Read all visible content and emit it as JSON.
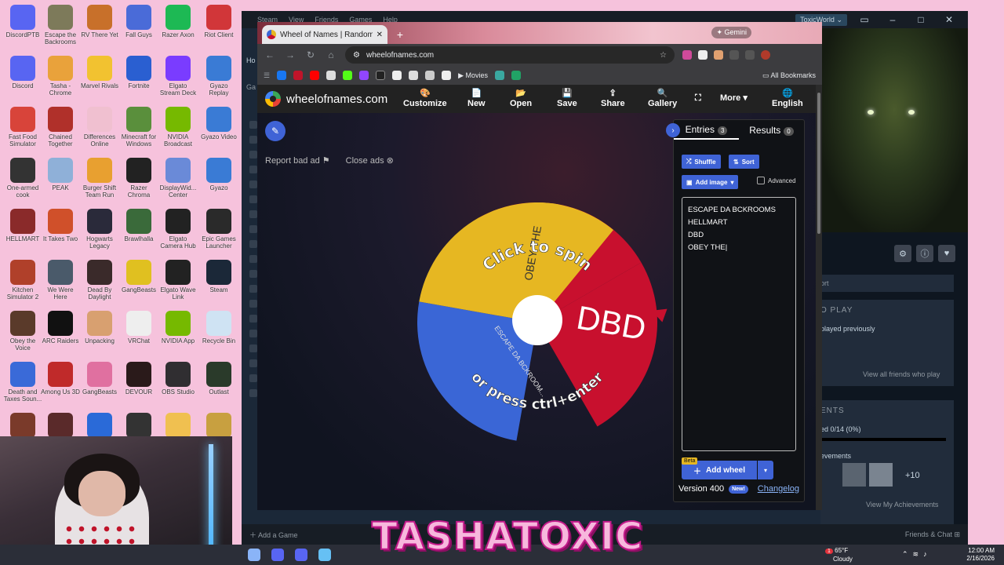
{
  "desktop": {
    "icons": [
      {
        "label": "DiscordPTB",
        "color": "#5865f2"
      },
      {
        "label": "Escape the Backrooms",
        "color": "#7d7a5a"
      },
      {
        "label": "RV There Yet",
        "color": "#c8702a"
      },
      {
        "label": "Fall Guys",
        "color": "#4a6bd8"
      },
      {
        "label": "Razer Axon",
        "color": "#1db954"
      },
      {
        "label": "Riot Client",
        "color": "#d13639"
      },
      {
        "label": "Discord",
        "color": "#5865f2"
      },
      {
        "label": "Tasha - Chrome",
        "color": "#e9a23b"
      },
      {
        "label": "Marvel Rivals",
        "color": "#f2c230"
      },
      {
        "label": "Fortnite",
        "color": "#2a5fd1"
      },
      {
        "label": "Elgato Stream Deck",
        "color": "#7a3cff"
      },
      {
        "label": "Gyazo Replay",
        "color": "#3a7bd5"
      },
      {
        "label": "Fast Food Simulator",
        "color": "#d8443a"
      },
      {
        "label": "Chained Together",
        "color": "#b0302a"
      },
      {
        "label": "Differences Online",
        "color": "#f0c0d0"
      },
      {
        "label": "Minecraft for Windows",
        "color": "#5a8f3c"
      },
      {
        "label": "NVIDIA Broadcast",
        "color": "#76b900"
      },
      {
        "label": "Gyazo Video",
        "color": "#3a7bd5"
      },
      {
        "label": "One-armed cook",
        "color": "#333333"
      },
      {
        "label": "PEAK",
        "color": "#8fb0d8"
      },
      {
        "label": "Burger Shift Team Run",
        "color": "#e8a030"
      },
      {
        "label": "Razer Chroma",
        "color": "#222222"
      },
      {
        "label": "DisplayWid... Center",
        "color": "#6a8ad8"
      },
      {
        "label": "Gyazo",
        "color": "#3a7bd5"
      },
      {
        "label": "HELLMART",
        "color": "#8a2a2a"
      },
      {
        "label": "It Takes Two",
        "color": "#d0502a"
      },
      {
        "label": "Hogwarts Legacy",
        "color": "#2a2a3a"
      },
      {
        "label": "Brawlhalla",
        "color": "#3a6a3a"
      },
      {
        "label": "Elgato Camera Hub",
        "color": "#222222"
      },
      {
        "label": "Epic Games Launcher",
        "color": "#2a2a2a"
      },
      {
        "label": "Kitchen Simulator 2",
        "color": "#b0402a"
      },
      {
        "label": "We Were Here",
        "color": "#4a5a6a"
      },
      {
        "label": "Dead By Daylight",
        "color": "#3a2a2a"
      },
      {
        "label": "GangBeasts",
        "color": "#e0c020"
      },
      {
        "label": "Elgato Wave Link",
        "color": "#222222"
      },
      {
        "label": "Steam",
        "color": "#1b2838"
      },
      {
        "label": "Obey the Voice",
        "color": "#5a3a2a"
      },
      {
        "label": "ARC Raiders",
        "color": "#111111"
      },
      {
        "label": "Unpacking",
        "color": "#d8a070"
      },
      {
        "label": "VRChat",
        "color": "#eeeeee"
      },
      {
        "label": "NVIDIA App",
        "color": "#76b900"
      },
      {
        "label": "Recycle Bin",
        "color": "#cfe3f3"
      },
      {
        "label": "Death and Taxes Soun...",
        "color": "#3a6ad8"
      },
      {
        "label": "Among Us 3D",
        "color": "#c02a2a"
      },
      {
        "label": "GangBeasts",
        "color": "#e070a0"
      },
      {
        "label": "DEVOUR",
        "color": "#2a1a1a"
      },
      {
        "label": "OBS Studio",
        "color": "#302e31"
      },
      {
        "label": "Outlast",
        "color": "#2a3a2a"
      },
      {
        "label": "",
        "color": "#7a3a2a"
      },
      {
        "label": "",
        "color": "#5a2a2a"
      },
      {
        "label": "",
        "color": "#2a6ad8"
      },
      {
        "label": "",
        "color": "#333333"
      },
      {
        "label": "",
        "color": "#f0c050"
      },
      {
        "label": "",
        "color": "#c8a040"
      }
    ]
  },
  "steam": {
    "menu": [
      "Steam",
      "View",
      "Friends",
      "Games",
      "Help"
    ],
    "account": "ToxicWorld",
    "sort_text": "ort",
    "play_header": "O PLAY",
    "played_previously": "played previously",
    "view_all_friends": "View all friends who play",
    "achievements_header": "ENTS",
    "achievements_progress": "ed 0/14 (0%)",
    "achievements_label": "evements",
    "achievements_more": "+10",
    "view_achievements": "View My Achievements",
    "add_game": "Add a Game",
    "friends_chat": "Friends & Chat",
    "home_tab": "Ho",
    "games_tab": "Ga"
  },
  "browser": {
    "tab_title": "Wheel of Names | Random nam",
    "gemini": "Gemini",
    "url": "wheelofnames.com",
    "bookmark_movies": "Movies",
    "all_bookmarks": "All Bookmarks"
  },
  "site": {
    "logo": "wheelofnames.com",
    "nav": [
      {
        "label": "Customize",
        "icon": "palette-icon",
        "glyph": "🎨"
      },
      {
        "label": "New",
        "icon": "file-icon",
        "glyph": "📄"
      },
      {
        "label": "Open",
        "icon": "folder-icon",
        "glyph": "📂"
      },
      {
        "label": "Save",
        "icon": "save-icon",
        "glyph": "💾"
      },
      {
        "label": "Share",
        "icon": "share-icon",
        "glyph": "⇪"
      },
      {
        "label": "Gallery",
        "icon": "search-icon",
        "glyph": "🔍"
      },
      {
        "label": "",
        "icon": "fullscreen-icon",
        "glyph": "⛶"
      },
      {
        "label": "More",
        "icon": "chevron-down-icon",
        "glyph": ""
      },
      {
        "label": "English",
        "icon": "globe-icon",
        "glyph": "🌐"
      }
    ],
    "report_ad": "Report bad ad",
    "close_ads": "Close ads",
    "wheel": {
      "segments": [
        {
          "label": "ESCAPE DA BCKROOMS",
          "color": "#3a66d6"
        },
        {
          "label": "HELLMART",
          "color": "#e6b722"
        },
        {
          "label": "DBD",
          "color": "#c8102e"
        },
        {
          "label": "OBEY THE",
          "color": "#e6b722"
        }
      ],
      "hint_top": "Click to spin",
      "hint_bottom": "or press ctrl+enter",
      "dbd_label": "DBD",
      "obey_label": "OBEY THE",
      "escape_label": "ESCAPE DA BCKROOM..."
    },
    "panel": {
      "tab_entries": "Entries",
      "entries_count": "3",
      "tab_results": "Results",
      "results_count": "0",
      "shuffle": "Shuffle",
      "sort": "Sort",
      "add_image": "Add image",
      "advanced": "Advanced",
      "entries": [
        "ESCAPE DA BCKROOMS",
        "HELLMART",
        "DBD",
        "OBEY THE"
      ],
      "beta": "Beta",
      "add_wheel": "Add wheel",
      "version": "Version 400",
      "new_badge": "New!",
      "changelog": "Changelog"
    }
  },
  "taskbar": {
    "temperature": "65°F",
    "weather": "Cloudy",
    "notif_count": "1",
    "time": "12:00 AM",
    "date": "2/16/2026"
  },
  "overlay": {
    "brand": "TASHATOXIC"
  },
  "colors": {
    "desktop_bg": "#f6c2dc",
    "accent_blue": "#3f63d6",
    "wheel_red": "#c8102e",
    "wheel_yellow": "#e6b722",
    "wheel_blue": "#3a66d6"
  }
}
